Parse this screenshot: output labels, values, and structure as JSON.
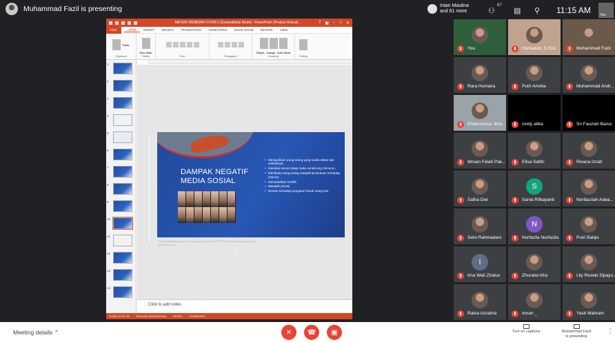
{
  "presenter": {
    "label": "Muhammad Fazil is presenting"
  },
  "powerpoint": {
    "window_title": "MATERI WEBINAR II KOM 1 [Compatibility Mode] - PowerPoint (Product Activati...",
    "window_controls": [
      "?",
      "▣",
      "–",
      "□",
      "✕"
    ],
    "file_tab": "FILE",
    "tabs": [
      "HOME",
      "INSERT",
      "DESIGN",
      "TRANSITIONS",
      "ANIMATIONS",
      "SLIDE SHOW",
      "REVIEW",
      "VIEW"
    ],
    "active_tab": "HOME",
    "ribbon_groups": [
      "Clipboard",
      "Slides",
      "Font",
      "Paragraph",
      "Drawing",
      "Editing"
    ],
    "ribbon_buttons": {
      "paste": "Paste",
      "new_slide": "New Slide",
      "shapes": "Shapes",
      "arrange": "Arrange",
      "quick_styles": "Quick Styles",
      "editing": "Editing"
    },
    "slide_numbers": [
      "1",
      "2",
      "3",
      "4",
      "5",
      "6",
      "7",
      "8",
      "9",
      "10",
      "11",
      "12",
      "13",
      "14"
    ],
    "selected_slide": "10",
    "slide": {
      "title_line1": "DAMPAK NEGATIF",
      "title_line2": "MEDIA SOSIAL",
      "bullets": [
        "Menjauhkan orang-orang yang sudah dekat dan sebaliknya.",
        "Interaksi secara tatap muka cenderung menurun.",
        "Membuat orang-orang menjadi kecanduan terhadap internet.",
        "Menimbulkan konflik.",
        "Masalah privasi.",
        "Rentan terhadap pengaruh buruk orang lain."
      ],
      "footnote": "This presentation uses a free template provided by FPPT.com www.free-power-point-templates.com"
    },
    "notes_placeholder": "Click to add notes",
    "status": {
      "slide": "SLIDE 10 OF 14",
      "language": "ENGLISH (INDONESIA)",
      "notes": "NOTES",
      "comments": "COMMENTS"
    }
  },
  "header": {
    "host_name": "Intan Maulina",
    "host_more": "and 61 more",
    "people_count": "67",
    "time": "11:15 AM",
    "self_label": "You"
  },
  "participants": [
    {
      "name": "You",
      "avatar": "photo",
      "color": "#2f5e3a"
    },
    {
      "name": "Humairah, S.Sos",
      "avatar": "photo",
      "color": "#bfa38f"
    },
    {
      "name": "Muhammad Fazil",
      "avatar": "photo",
      "color": "#6b5a4a"
    },
    {
      "name": "Rara Humaira",
      "avatar": "photo",
      "color": "#3c4043"
    },
    {
      "name": "Putri Amelia",
      "avatar": "photo",
      "color": "#3c4043"
    },
    {
      "name": "Muhammad Andr...",
      "avatar": "photo",
      "color": "#3c4043"
    },
    {
      "name": "Khairunnisa, Ikha",
      "avatar": "photo",
      "color": "#9aa3a8"
    },
    {
      "name": "cindy atika",
      "avatar": "none",
      "color": "#000000"
    },
    {
      "name": "Sri Fauziah Barus",
      "avatar": "none",
      "color": "#000000"
    },
    {
      "name": "Ikhsan Falah Pak...",
      "avatar": "photo",
      "color": "#3c4043"
    },
    {
      "name": "Elisa Safitri",
      "avatar": "photo",
      "color": "#3c4043"
    },
    {
      "name": "Rivana Izzati",
      "avatar": "photo",
      "color": "#3c4043"
    },
    {
      "name": "Safira Dwi",
      "avatar": "photo",
      "color": "#3c4043"
    },
    {
      "name": "Sania Rifkayanti",
      "avatar": "S",
      "avatar_color": "#12a37f",
      "color": "#3c4043"
    },
    {
      "name": "Norfauziah Adea...",
      "avatar": "photo",
      "color": "#3c4043"
    },
    {
      "name": "Selvi Rahmadani",
      "avatar": "photo",
      "color": "#3c4043"
    },
    {
      "name": "Nurfazila Nurfazila",
      "avatar": "N",
      "avatar_color": "#7e57c2",
      "color": "#3c4043"
    },
    {
      "name": "Putri Balqis",
      "avatar": "photo",
      "color": "#3c4043"
    },
    {
      "name": "Irna Wati Ziraluo",
      "avatar": "I",
      "avatar_color": "#5f6e84",
      "color": "#3c4043"
    },
    {
      "name": "Zhuratul Afra",
      "avatar": "photo",
      "color": "#3c4043"
    },
    {
      "name": "Lily Rezeki Sipayu...",
      "avatar": "photo",
      "color": "#3c4043"
    },
    {
      "name": "Raina Azzahra",
      "avatar": "photo",
      "color": "#3c4043"
    },
    {
      "name": "Imran _",
      "avatar": "photo",
      "color": "#3c4043"
    },
    {
      "name": "Yasir Mahram",
      "avatar": "photo",
      "color": "#3c4043"
    }
  ],
  "bottom_bar": {
    "meeting_details": "Meeting details",
    "captions": "Turn on captions",
    "presenting_line1": "Muhammad Fazil",
    "presenting_line2": "is presenting",
    "accent": "#ea4335"
  }
}
